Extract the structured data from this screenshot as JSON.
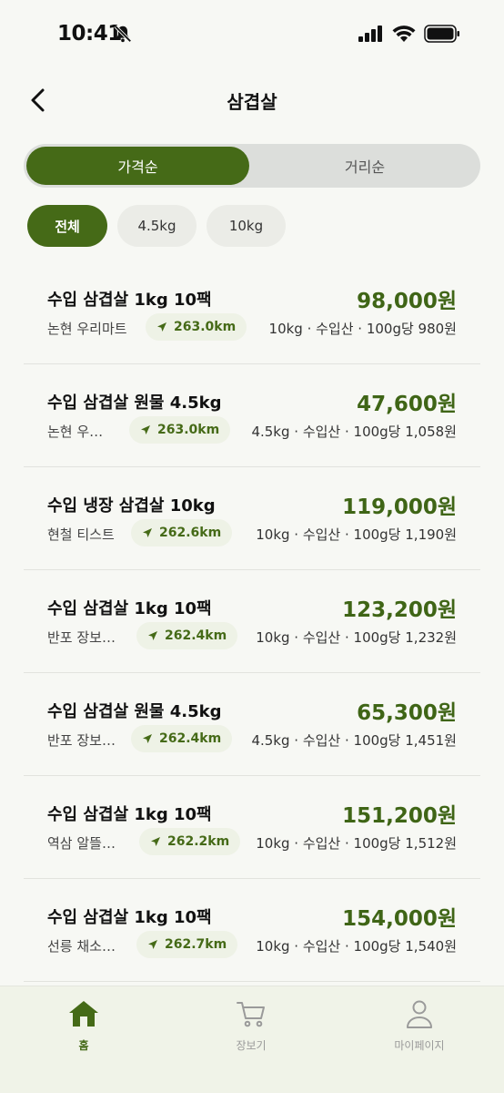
{
  "status": {
    "time": "10:41"
  },
  "header": {
    "title": "삼겹살"
  },
  "sort": {
    "options": [
      "가격순",
      "거리순"
    ],
    "active": "가격순"
  },
  "filters": [
    "전체",
    "4.5kg",
    "10kg"
  ],
  "items": [
    {
      "name": "수입 삼겹살 1kg 10팩",
      "price": "98,000원",
      "store": "논현 우리마트",
      "distance": "263.0km",
      "meta": "10kg · 수입산 · 100g당 980원"
    },
    {
      "name": "수입 삼겹살 원물 4.5kg",
      "price": "47,600원",
      "store": "논현 우…",
      "distance": "263.0km",
      "meta": "4.5kg · 수입산 · 100g당 1,058원"
    },
    {
      "name": "수입 냉장 삼겹살 10kg",
      "price": "119,000원",
      "store": "현철 티스트",
      "distance": "262.6km",
      "meta": "10kg · 수입산 · 100g당 1,190원"
    },
    {
      "name": "수입 삼겹살 1kg 10팩",
      "price": "123,200원",
      "store": "반포 장보…",
      "distance": "262.4km",
      "meta": "10kg · 수입산 · 100g당 1,232원"
    },
    {
      "name": "수입 삼겹살 원물 4.5kg",
      "price": "65,300원",
      "store": "반포 장보…",
      "distance": "262.4km",
      "meta": "4.5kg · 수입산 · 100g당 1,451원"
    },
    {
      "name": "수입 삼겹살 1kg 10팩",
      "price": "151,200원",
      "store": "역삼 알뜰…",
      "distance": "262.2km",
      "meta": "10kg · 수입산 · 100g당 1,512원"
    },
    {
      "name": "수입 삼겹살 1kg 10팩",
      "price": "154,000원",
      "store": "선릉 채소…",
      "distance": "262.7km",
      "meta": "10kg · 수입산 · 100g당 1,540원"
    }
  ],
  "tabbar": {
    "home": "홈",
    "shopping": "장보기",
    "mypage": "마이페이지"
  },
  "colors": {
    "accent": "#456a17",
    "price": "#3f6516"
  }
}
